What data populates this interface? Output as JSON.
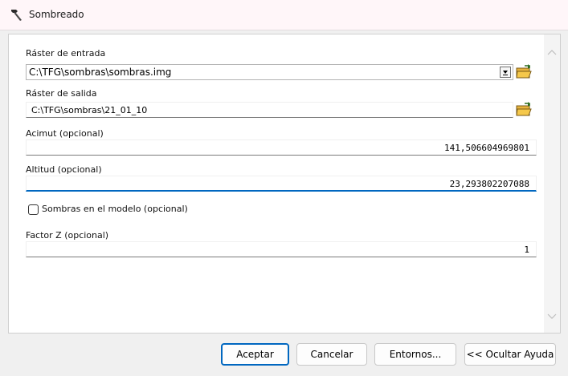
{
  "window": {
    "title": "Sombreado",
    "icon": "hammer-icon"
  },
  "fields": {
    "input_raster": {
      "label": "Ráster de entrada",
      "value": "C:\\TFG\\sombras\\sombras.img"
    },
    "output_raster": {
      "label": "Ráster de salida",
      "value": "C:\\TFG\\sombras\\21_01_10"
    },
    "azimuth": {
      "label": "Acimut (opcional)",
      "value": "141,506604969801"
    },
    "altitude": {
      "label": "Altitud (opcional)",
      "value": "23,293802207088"
    },
    "model_shadows": {
      "label": "Sombras en el modelo (opcional)",
      "checked": false
    },
    "z_factor": {
      "label": "Factor Z (opcional)",
      "value": "1"
    }
  },
  "buttons": {
    "ok": "Aceptar",
    "cancel": "Cancelar",
    "environments": "Entornos...",
    "hide_help": "<< Ocultar Ayuda"
  },
  "colors": {
    "accent": "#0067c0",
    "titlebar": "#fff6f9",
    "folder": "#f5c84b"
  }
}
